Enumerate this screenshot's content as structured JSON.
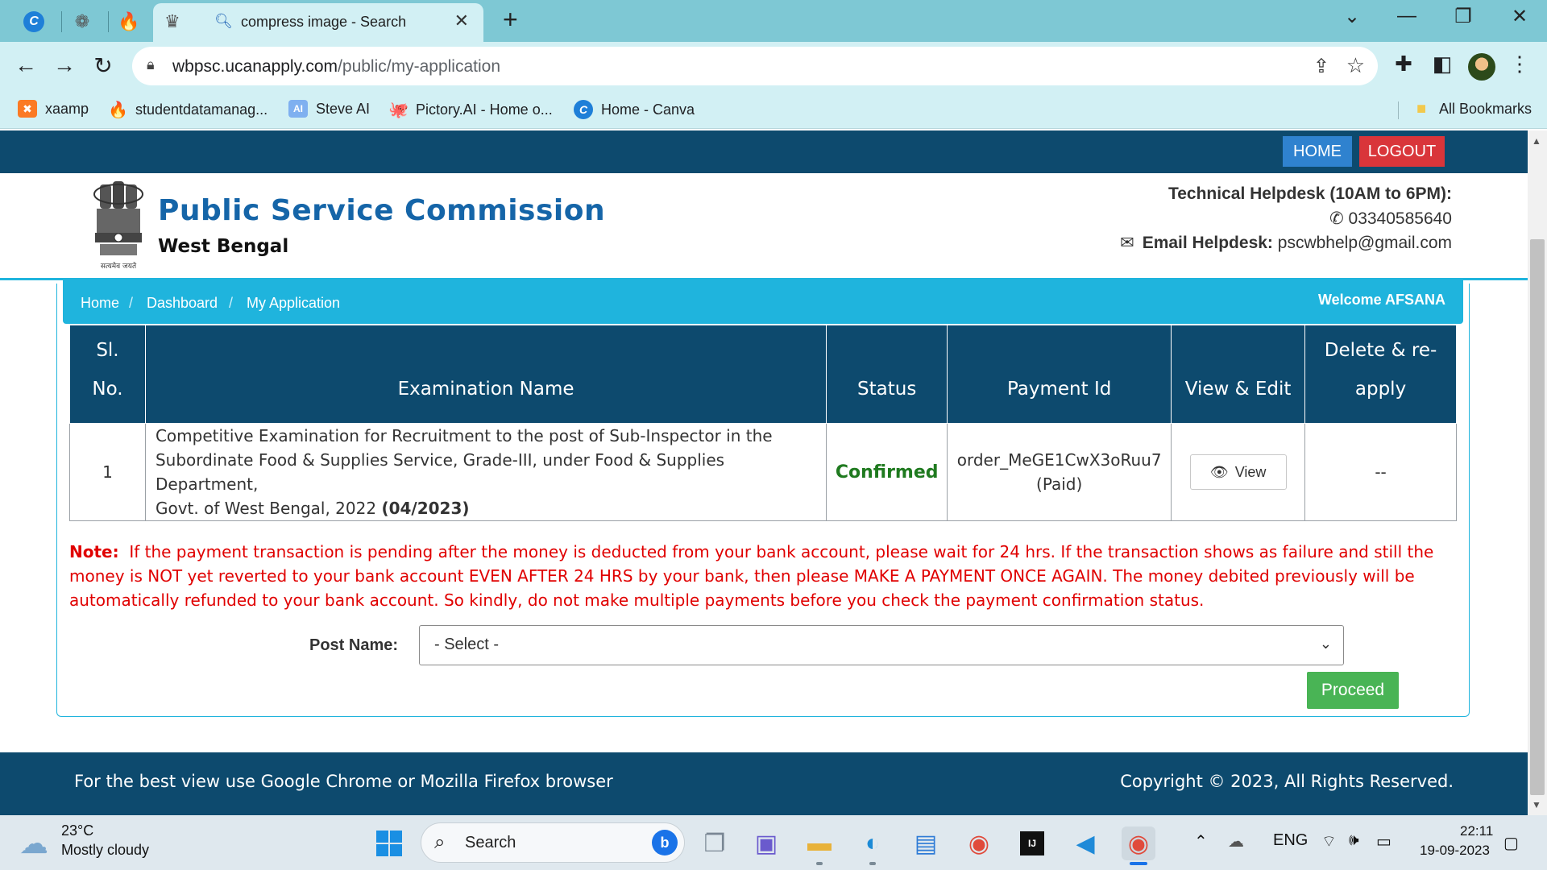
{
  "browser": {
    "tabs": [
      {
        "icon": "canva-icon",
        "glyph": "C"
      },
      {
        "icon": "openai-icon",
        "glyph": "❁"
      },
      {
        "icon": "fire-icon",
        "glyph": "🔥"
      },
      {
        "icon": "emblem-tab-icon",
        "glyph": "♛"
      }
    ],
    "active_tab": {
      "title": "compress image - Search",
      "icon": "search-icon"
    },
    "url_host": "wbpsc.ucanapply.com",
    "url_path": "/public/my-application",
    "bookmarks": [
      {
        "label": "xaamp",
        "icon": "xampp-icon",
        "glyph": "✖"
      },
      {
        "label": "studentdatamanag...",
        "icon": "fire-icon",
        "glyph": "🔥"
      },
      {
        "label": "Steve AI",
        "icon": "steve-ai-icon",
        "glyph": "AI"
      },
      {
        "label": "Pictory.AI - Home o...",
        "icon": "octopus-icon",
        "glyph": "🐙"
      },
      {
        "label": "Home - Canva",
        "icon": "canva-icon",
        "glyph": "C"
      }
    ],
    "all_bookmarks": "All Bookmarks"
  },
  "site": {
    "nav": {
      "home": "HOME",
      "logout": "LOGOUT"
    },
    "org_title": "Public Service Commission",
    "org_subtitle": "West Bengal",
    "emblem_caption": "सत्यमेव जयते",
    "helpdesk_title": "Technical Helpdesk (10AM to 6PM):",
    "helpdesk_phone": "03340585640",
    "email_label": "Email Helpdesk:",
    "email_value": "pscwbhelp@gmail.com",
    "breadcrumb": [
      "Home",
      "Dashboard",
      "My Application"
    ],
    "welcome": "Welcome AFSANA"
  },
  "table": {
    "headers": {
      "slno_line1": "Sl.",
      "slno_line2": "No.",
      "exam": "Examination Name",
      "status": "Status",
      "payment": "Payment Id",
      "view": "View & Edit",
      "delete_line1": "Delete & re-",
      "delete_line2": "apply"
    },
    "rows": [
      {
        "slno": "1",
        "exam_line1": "Competitive Examination for Recruitment to the post of Sub-Inspector in the",
        "exam_line2": "Subordinate Food & Supplies Service, Grade-III, under Food & Supplies Department,",
        "exam_line3": "Govt. of West Bengal, 2022",
        "exam_code": "(04/2023)",
        "status": "Confirmed",
        "payment_id": "order_MeGE1CwX3oRuu7",
        "payment_state": "(Paid)",
        "view_label": "View",
        "delete": "--"
      }
    ]
  },
  "note": {
    "label": "Note:",
    "text": "If the payment transaction is pending after the money is deducted from your bank account, please wait for 24 hrs. If the transaction shows as failure and still the money is NOT yet reverted to your bank account EVEN AFTER 24 HRS by your bank, then please MAKE A PAYMENT ONCE AGAIN. The money debited previously will be automatically refunded to your bank account. So kindly, do not make multiple payments before you check the payment confirmation status."
  },
  "form": {
    "post_label": "Post Name:",
    "post_selected": "- Select -",
    "proceed": "Proceed"
  },
  "footer": {
    "left": "For the best view use Google Chrome or Mozilla Firefox browser",
    "right": "Copyright © 2023, All Rights Reserved."
  },
  "taskbar": {
    "temp": "23°C",
    "weather": "Mostly cloudy",
    "search": "Search",
    "lang": "ENG",
    "time": "22:11",
    "date": "19-09-2023"
  },
  "colors": {
    "navy": "#0d4a6e",
    "cyan": "#1fb4dd",
    "confirmed": "#1f7a1f",
    "note": "#e00000",
    "proceed": "#49b455",
    "home_btn": "#2f82cf",
    "logout_btn": "#d9353a"
  }
}
